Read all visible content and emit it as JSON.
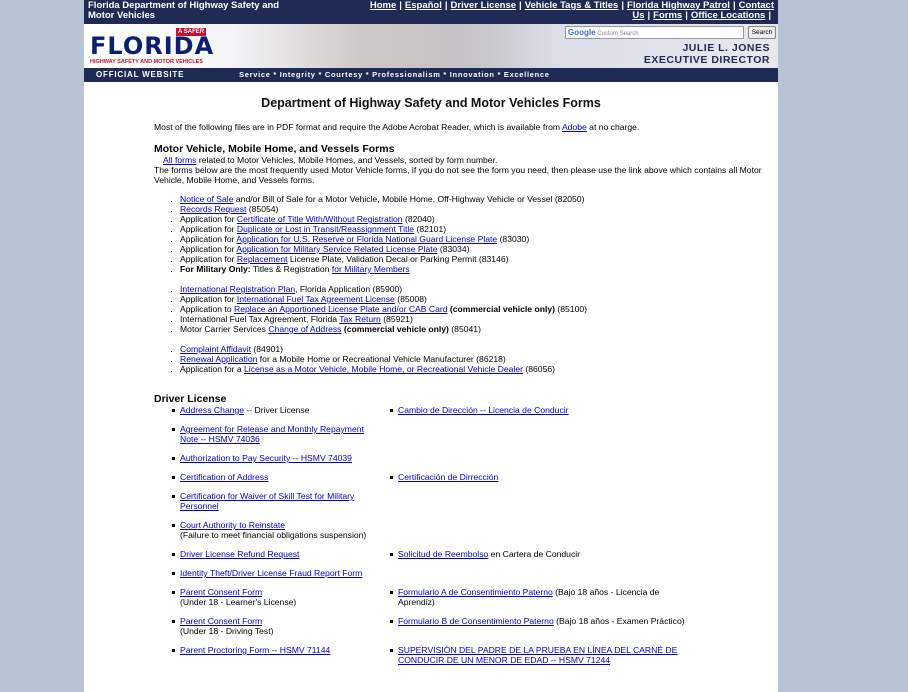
{
  "header": {
    "site_name": "Florida Department of Highway Safety and Motor Vehicles",
    "nav": [
      "Home",
      "Español",
      "Driver License",
      "Vehicle Tags & Titles",
      "Florida Highway Patrol",
      "Contact Us",
      "Forms",
      "Office Locations"
    ],
    "logo_text": "FLORIDA",
    "logo_tag": "A SAFER",
    "logo_sub": "HIGHWAY SAFETY AND MOTOR VEHICLES",
    "search_placeholder": "Custom Search",
    "search_brand": "Google",
    "search_button": "Search",
    "director_name": "JULIE L. JONES",
    "director_title": "EXECUTIVE DIRECTOR",
    "official_label": "OFFICIAL WEBSITE",
    "values": "Service * Integrity * Courtesy * Professionalism * Innovation * Excellence"
  },
  "main": {
    "title": "Department of Highway Safety and Motor Vehicles Forms",
    "intro_pre": "Most of the following files are in PDF format and require the Adobe Acrobat Reader, which is available from ",
    "intro_link": "Adobe",
    "intro_post": " at no charge.",
    "mv_heading": "Motor Vehicle, Mobile Home, and Vessels Forms",
    "mv_all_link": "All forms",
    "mv_all_text": " related to Motor Vehicles, Mobile Homes, and Vessels, sorted by form number.",
    "mv_note": "The forms below are the most frequently used Motor Vehicle forms, if you do not see the form you need, then please use the link above which contains all Motor Vehicle, Mobile Home, and Vessels forms.",
    "mv_group1": [
      {
        "pre": "",
        "link": "Notice of Sale",
        "post": " and/or Bill of Sale for a Motor Vehicle, Mobile Home, Off-Highway Vehicle or Vessel (82050)"
      },
      {
        "pre": "",
        "link": "Records Request",
        "post": " (85054)"
      },
      {
        "pre": "Application for ",
        "link": "Certificate of Title With/Without Registration",
        "post": " (82040)"
      },
      {
        "pre": "Application for ",
        "link": "Duplicate or Lost in Transit/Reassignment Title",
        "post": " (82101)"
      },
      {
        "pre": "Application for ",
        "link": "Application for U.S. Reserve or Florida National Guard License Plate",
        "post": " (83030)"
      },
      {
        "pre": "Application for ",
        "link": "Application for Military Service Related License Plate",
        "post": " (83034)"
      },
      {
        "pre": "Application for ",
        "link": "Replacement",
        "post": " License Plate, Validation Decal or Parking Permit (83146)"
      },
      {
        "bold": "For Military Only:",
        "pre": " Titles & Registration ",
        "link": "for Military Members",
        "post": ""
      }
    ],
    "mv_group2": [
      {
        "pre": "",
        "link": "International Registration Plan",
        "post": ", Florida Application (85900)"
      },
      {
        "pre": "Application for ",
        "link": "International Fuel Tax Agreement License",
        "post": " (85008)"
      },
      {
        "pre": "Application to ",
        "link": "Replace an Apportioned License Plate and/or CAB Card",
        "bold": " (commercial vehicle only)",
        "post": " (85100)"
      },
      {
        "pre": "International Fuel Tax Agreement, Florida ",
        "link": "Tax Return",
        "post": " (85921)"
      },
      {
        "pre": "Motor Carrier Services ",
        "link": "Change of Address",
        "bold": " (commercial vehicle only)",
        "post": " (85041)"
      }
    ],
    "mv_group3": [
      {
        "pre": "",
        "link": "Complaint Affidavit",
        "post": " (84901)"
      },
      {
        "pre": "",
        "link": "Renewal Application",
        "post": " for a Mobile Home or Recreational Vehicle Manufacturer (86218)"
      },
      {
        "pre": "Application for a ",
        "link": "License as a Motor Vehicle, Mobile Home, or Recreational Vehicle Dealer",
        "post": " (86056)"
      }
    ],
    "dl_heading": "Driver License",
    "dl_rows": [
      {
        "l_link": "Address Change",
        "l_text": " -- Driver License",
        "r_link": "Cambio de Dirección -- Licencia de Conducir",
        "r_text": ""
      },
      {
        "l_link": "Agreement for Release and Monthly Repayment Note -- HSMV 74036",
        "l_text": "",
        "r_link": "",
        "r_text": ""
      },
      {
        "l_link": "Authorization to Pay Security -- HSMV 74039",
        "l_text": "",
        "r_link": "",
        "r_text": ""
      },
      {
        "l_link": "Certification of Address",
        "l_text": "",
        "r_link": "Certificación de Dirrección",
        "r_text": ""
      },
      {
        "l_link": "Certification for Waiver of Skill Test for Military Personnel",
        "l_text": "",
        "r_link": "",
        "r_text": ""
      },
      {
        "l_link": "Court Authority to Reinstate",
        "l_text": "(Failure to meet financial obligations suspension)",
        "r_link": "",
        "r_text": ""
      },
      {
        "l_link": "Driver License Refund Request",
        "l_text": "",
        "r_link": "Solicitud de Reembolso",
        "r_text": " en Cartera de Conducir"
      },
      {
        "l_link": "Identity Theft/Driver License Fraud Report Form",
        "l_text": "",
        "r_link": "",
        "r_text": ""
      },
      {
        "l_link": "Parent Consent Form",
        "l_text": "(Under 18 - Learner's License)",
        "r_link": "Formulario A de Consentimiento Paterno",
        "r_text": " (Bajo 18 años - Licencia de Aprendiz)"
      },
      {
        "l_link": "Parent Consent Form",
        "l_text": "(Under 18 - Driving Test)",
        "r_link": "Formulario B de Consentimiento Paterno",
        "r_text": " (Bajo 18 años - Examen Práctico)"
      },
      {
        "l_link": "Parent Proctoring Form -- HSMV 71144",
        "l_text": "",
        "r_link": "SUPERVISIÓN DEL PADRE DE LA PRUEBA EN LÍNEA DEL CARNÉ DE CONDUCIR DE UN MENOR DE EDAD -- HSMV 71244",
        "r_text": ""
      }
    ]
  }
}
